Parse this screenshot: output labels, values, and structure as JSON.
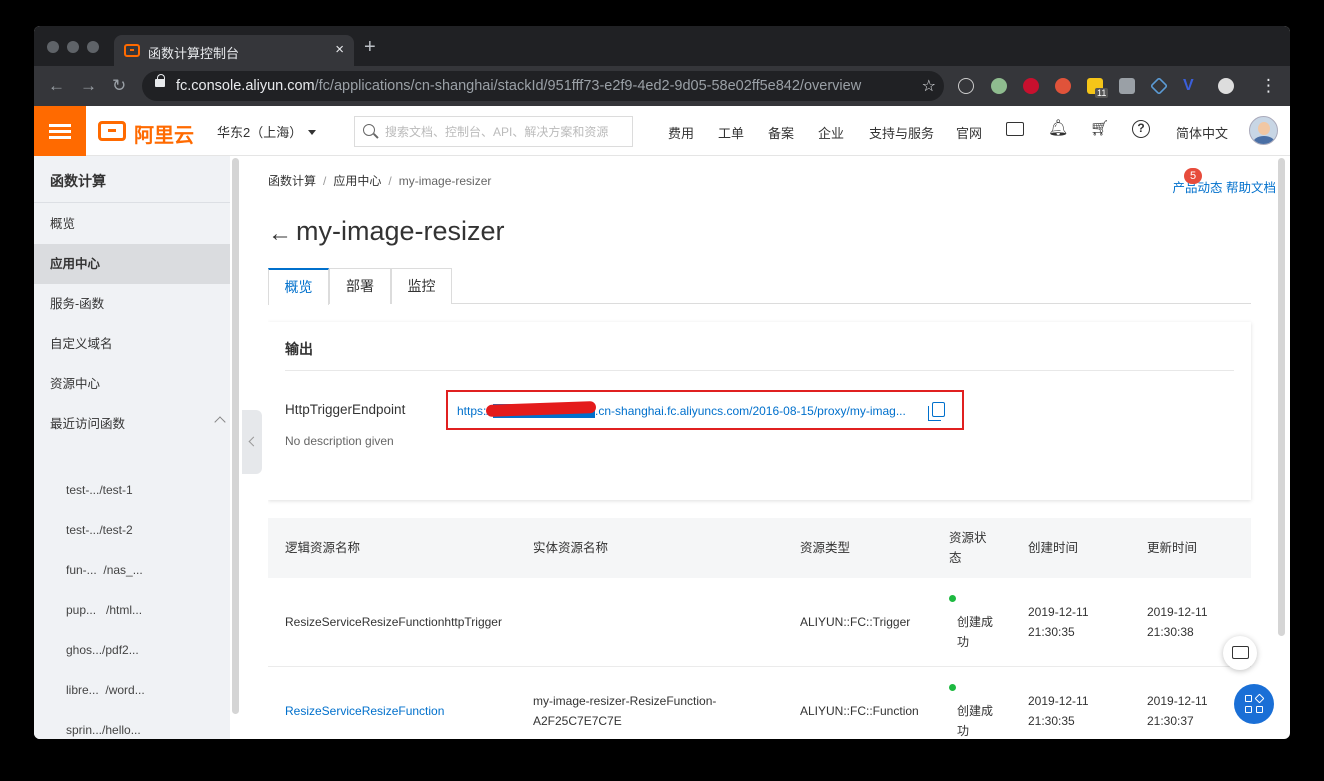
{
  "browser": {
    "tab_title": "函数计算控制台",
    "tab_close": "×",
    "new_tab": "+",
    "url_host": "fc.console.aliyun.com",
    "url_path": "/fc/applications/cn-shanghai/stackId/951fff73-e2f9-4ed2-9d05-58e02ff5e842/overview",
    "ext_badge": "11"
  },
  "header": {
    "logo_text": "阿里云",
    "region": "华东2（上海）",
    "search_placeholder": "搜索文档、控制台、API、解决方案和资源",
    "links": [
      "费用",
      "工单",
      "备案",
      "企业",
      "支持与服务",
      "官网"
    ],
    "language": "简体中文"
  },
  "sidebar": {
    "title": "函数计算",
    "items": [
      {
        "label": "概览"
      },
      {
        "label": "应用中心"
      },
      {
        "label": "服务-函数"
      },
      {
        "label": "自定义域名"
      },
      {
        "label": "资源中心"
      },
      {
        "label": "最近访问函数"
      }
    ],
    "recent": [
      {
        "service": "test-...",
        "fn": "/test-1"
      },
      {
        "service": "test-...",
        "fn": "/test-2"
      },
      {
        "service": "fun-...",
        "fn": "/nas_..."
      },
      {
        "service": "pup...",
        "fn": "/html..."
      },
      {
        "service": "ghos...",
        "fn": "/pdf2..."
      },
      {
        "service": "libre...",
        "fn": "/word..."
      },
      {
        "service": "sprin...",
        "fn": "/hello..."
      }
    ]
  },
  "main": {
    "breadcrumb": [
      "函数计算",
      "应用中心",
      "my-image-resizer"
    ],
    "product_news": "产品动态",
    "news_count": "5",
    "help_docs": "帮助文档",
    "title": "my-image-resizer",
    "tabs": [
      "概览",
      "部署",
      "监控"
    ],
    "output": {
      "title": "输出",
      "key": "HttpTriggerEndpoint",
      "value": "https://████████████.cn-shanghai.fc.aliyuncs.com/2016-08-15/proxy/my-imag...",
      "description": "No description given"
    },
    "table": {
      "headers": [
        "逻辑资源名称",
        "实体资源名称",
        "资源类型",
        "资源状态",
        "创建时间",
        "更新时间"
      ],
      "rows": [
        {
          "logical": "ResizeServiceResizeFunctionhttpTrigger",
          "physical": "",
          "type": "ALIYUN::FC::Trigger",
          "status": "创建成功",
          "created": "2019-12-11 21:30:35",
          "updated": "2019-12-11 21:30:38"
        },
        {
          "logical": "ResizeServiceResizeFunction",
          "physical": "my-image-resizer-ResizeFunction-A2F25C7E7C7E",
          "type": "ALIYUN::FC::Function",
          "status": "创建成功",
          "created": "2019-12-11 21:30:35",
          "updated": "2019-12-11 21:30:37"
        }
      ]
    }
  },
  "colors": {
    "brand": "#ff6a00",
    "link": "#0070cc",
    "highlight": "#e02020",
    "status_ok": "#1db940"
  }
}
